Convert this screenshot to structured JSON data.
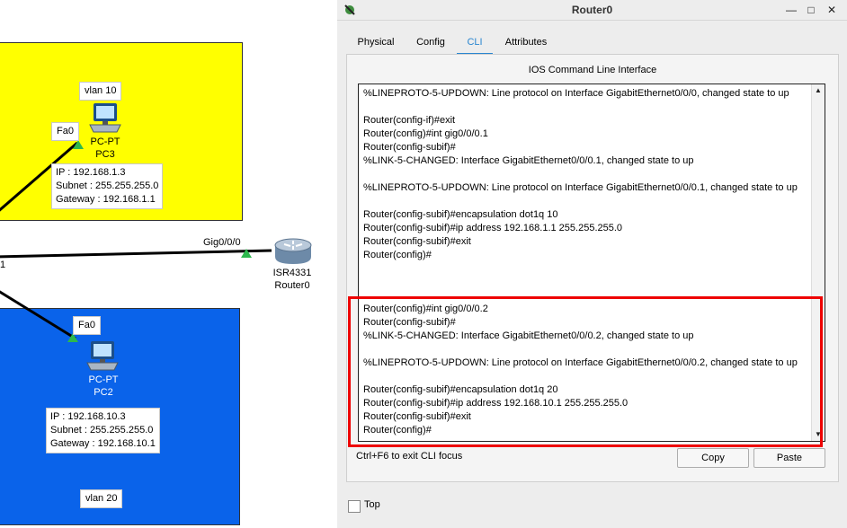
{
  "topology": {
    "pc3": {
      "vlan_label": "vlan 10",
      "port": "Fa0",
      "type": "PC-PT",
      "name": "PC3",
      "ip": "IP : 192.168.1.3",
      "subnet": "Subnet : 255.255.255.0",
      "gateway": "Gateway : 192.168.1.1"
    },
    "pc2": {
      "vlan_label": "vlan 20",
      "port": "Fa0",
      "type": "PC-PT",
      "name": "PC2",
      "ip": "IP : 192.168.10.3",
      "subnet": "Subnet : 255.255.255.0",
      "gateway": "Gateway : 192.168.10.1"
    },
    "router": {
      "port": "Gig0/0/0",
      "model": "ISR4331",
      "name": "Router0"
    },
    "stray_label": "1",
    "colors": {
      "vlan10_zone": "#ffff00",
      "vlan20_zone": "#0a63ea",
      "link_up": "#2db84d"
    }
  },
  "window": {
    "title": "Router0",
    "tabs": [
      "Physical",
      "Config",
      "CLI",
      "Attributes"
    ],
    "active_tab": "CLI",
    "cli_title": "IOS Command Line Interface",
    "cli_lines": [
      "%LINEPROTO-5-UPDOWN: Line protocol on Interface GigabitEthernet0/0/0, changed state to up",
      "",
      "Router(config-if)#exit",
      "Router(config)#int gig0/0/0.1",
      "Router(config-subif)#",
      "%LINK-5-CHANGED: Interface GigabitEthernet0/0/0.1, changed state to up",
      "",
      "%LINEPROTO-5-UPDOWN: Line protocol on Interface GigabitEthernet0/0/0.1, changed state to up",
      "",
      "Router(config-subif)#encapsulation dot1q 10",
      "Router(config-subif)#ip address 192.168.1.1 255.255.255.0",
      "Router(config-subif)#exit",
      "Router(config)#",
      "",
      "",
      "",
      "Router(config)#int gig0/0/0.2",
      "Router(config-subif)#",
      "%LINK-5-CHANGED: Interface GigabitEthernet0/0/0.2, changed state to up",
      "",
      "%LINEPROTO-5-UPDOWN: Line protocol on Interface GigabitEthernet0/0/0.2, changed state to up",
      "",
      "Router(config-subif)#encapsulation dot1q 20",
      "Router(config-subif)#ip address 192.168.10.1 255.255.255.0",
      "Router(config-subif)#exit",
      "Router(config)#"
    ],
    "hint": "Ctrl+F6 to exit CLI focus",
    "copy_label": "Copy",
    "paste_label": "Paste",
    "top_label": "Top",
    "top_checked": false,
    "highlight_color": "#ee0000"
  }
}
